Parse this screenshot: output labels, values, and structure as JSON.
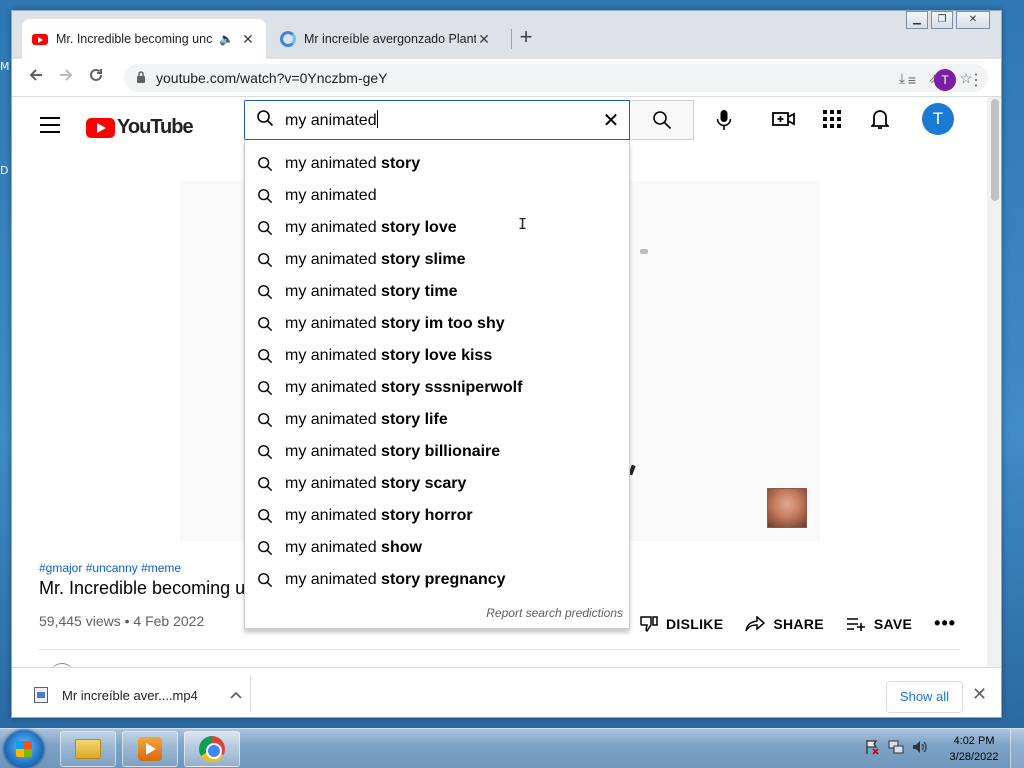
{
  "desktop": {
    "edge_letters": [
      "M",
      "D"
    ]
  },
  "browser": {
    "tabs": [
      {
        "title": "Mr. Incredible becoming unc",
        "active": true
      },
      {
        "title": "Mr increíble avergonzado Plantill",
        "active": false
      }
    ],
    "new_tab": "+",
    "window_controls": {
      "minimize": "▭",
      "restore": "❐",
      "close": "✕"
    },
    "url": "youtube.com/watch?v=0Ynczbm-geY"
  },
  "youtube": {
    "logo_text": "YouTube",
    "search": {
      "query": "my animated",
      "clear_symbol": "✕",
      "suggestions": [
        {
          "prefix": "my animated",
          "completion": " story"
        },
        {
          "prefix": "my animated",
          "completion": ""
        },
        {
          "prefix": "my animated",
          "completion": " story love"
        },
        {
          "prefix": "my animated",
          "completion": " story slime"
        },
        {
          "prefix": "my animated",
          "completion": " story time"
        },
        {
          "prefix": "my animated",
          "completion": " story im too shy"
        },
        {
          "prefix": "my animated",
          "completion": " story love kiss"
        },
        {
          "prefix": "my animated",
          "completion": " story sssniperwolf"
        },
        {
          "prefix": "my animated",
          "completion": " story life"
        },
        {
          "prefix": "my animated",
          "completion": " story billionaire"
        },
        {
          "prefix": "my animated",
          "completion": " story scary"
        },
        {
          "prefix": "my animated",
          "completion": " story horror"
        },
        {
          "prefix": "my animated",
          "completion": " show"
        },
        {
          "prefix": "my animated",
          "completion": " story pregnancy"
        }
      ],
      "report_link": "Report search predictions"
    },
    "avatar_letter": "T",
    "video": {
      "hashtags": "#gmajor #uncanny #meme",
      "title": "Mr. Incredible becoming uncanny",
      "meta": "59,445 views • 4 Feb 2022",
      "actions": {
        "dislike": "DISLIKE",
        "share": "SHARE",
        "save": "SAVE",
        "more": "•••"
      }
    }
  },
  "downloads": {
    "file_name": "Mr increíble aver....mp4",
    "show_all": "Show all",
    "close": "✕"
  },
  "taskbar": {
    "time": "4:02 PM",
    "date": "3/28/2022"
  },
  "colors": {
    "youtube_red": "#ff0000",
    "link_blue": "#065fd4",
    "search_focus": "#1c62b9",
    "avatar_blue": "#1a7ad4",
    "profile_purple": "#7b1fa2"
  }
}
